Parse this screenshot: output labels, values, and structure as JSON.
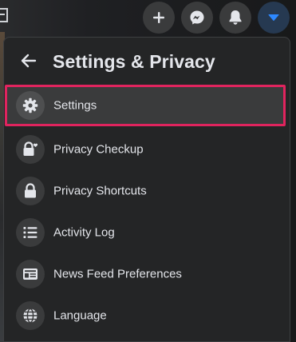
{
  "topbar": {
    "buttons": [
      {
        "icon": "plus-icon",
        "label": "Create"
      },
      {
        "icon": "messenger-icon",
        "label": "Messenger"
      },
      {
        "icon": "bell-icon",
        "label": "Notifications"
      },
      {
        "icon": "caret-down-icon",
        "label": "Account",
        "active": true
      }
    ]
  },
  "panel": {
    "title": "Settings & Privacy",
    "back_icon": "back-arrow-icon",
    "items": [
      {
        "label": "Settings",
        "icon": "gear-icon",
        "selected": true
      },
      {
        "label": "Privacy Checkup",
        "icon": "lock-heart-icon"
      },
      {
        "label": "Privacy Shortcuts",
        "icon": "lock-icon"
      },
      {
        "label": "Activity Log",
        "icon": "list-icon"
      },
      {
        "label": "News Feed Preferences",
        "icon": "feed-icon"
      },
      {
        "label": "Language",
        "icon": "globe-icon"
      }
    ]
  },
  "colors": {
    "panel_bg": "#242526",
    "icon_circle": "#3a3b3c",
    "text": "#e4e6eb",
    "highlight_border": "#e0245e",
    "active_button": "#263951",
    "active_accent": "#2d88ff"
  }
}
